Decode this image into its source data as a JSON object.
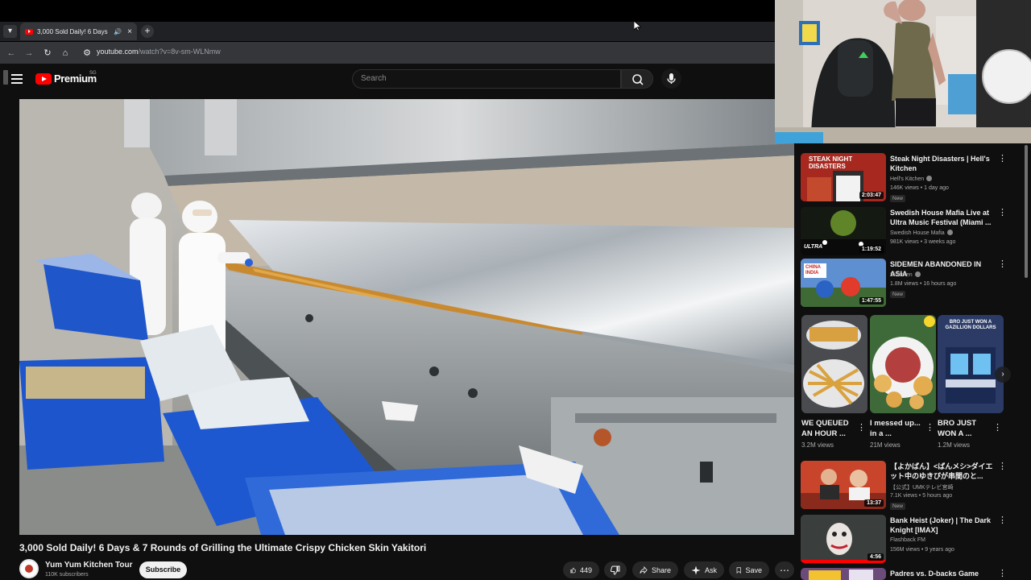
{
  "browser": {
    "tab_title": "3,000 Sold Daily! 6 Days &",
    "new_tab_label": "+",
    "url_host": "youtube.com",
    "url_path": "/watch?v=8v-sm-WLNmw"
  },
  "header": {
    "logo_text": "Premium",
    "country_code": "SG",
    "search_placeholder": "Search"
  },
  "video": {
    "title": "3,000 Sold Daily! 6 Days & 7 Rounds of Grilling the Ultimate Crispy Chicken Skin Yakitori",
    "channel": "Yum Yum Kitchen Tour",
    "subscribers": "110K subscribers",
    "subscribe_label": "Subscribe",
    "likes": "449",
    "share_label": "Share",
    "ask_label": "Ask",
    "save_label": "Save"
  },
  "sidebar": {
    "recommendations": [
      {
        "title": "Steak Night Disasters | Hell's Kitchen",
        "channel": "Hell's Kitchen",
        "meta": "146K views • 1 day ago",
        "badge": "New",
        "duration": "2:03:47",
        "thumb_text": "STEAK NIGHT DISASTERS",
        "thumb_color": "#b3261e"
      },
      {
        "title": "Swedish House Mafia Live at Ultra Music Festival (Miami ...",
        "channel": "Swedish House Mafia",
        "meta": "981K views • 3 weeks ago",
        "badge": "",
        "duration": "1:19:52",
        "thumb_text": "ULTRA",
        "thumb_color": "#1d2a1a"
      },
      {
        "title": "SIDEMEN ABANDONED IN ASIA",
        "channel": "Sidemen",
        "meta": "1.8M views • 16 hours ago",
        "badge": "New",
        "duration": "1:47:55",
        "thumb_text": "CHINA INDIA",
        "thumb_color": "#3d6fb6"
      },
      {
        "title": "【よかばん】<ばんメシ>ダイエット中のゆきぴが串間のと...",
        "channel": "【公式】UMKテレビ宮崎",
        "meta": "7.1K views • 5 hours ago",
        "badge": "New",
        "duration": "13:37",
        "thumb_text": "",
        "thumb_color": "#c97c2a"
      },
      {
        "title": "Bank Heist (Joker) | The Dark Knight [IMAX]",
        "channel": "Flashback FM",
        "meta": "156M views • 9 years ago",
        "badge": "",
        "duration": "4:56",
        "thumb_text": "",
        "thumb_color": "#2b2b2b"
      },
      {
        "title": "Padres vs. D-backs Game",
        "channel": "",
        "meta": "",
        "badge": "",
        "duration": "",
        "thumb_text": "",
        "thumb_color": "#6b4b7a"
      }
    ],
    "shorts": [
      {
        "title": "WE QUEUED AN HOUR ...",
        "views": "3.2M views",
        "thumb_color": "#c6a35a"
      },
      {
        "title": "I messed up... in a ...",
        "views": "21M views",
        "thumb_color": "#d9a055"
      },
      {
        "title": "BRO JUST WON A ...",
        "views": "1.2M views",
        "thumb_color": "#4a6fa5",
        "thumb_text": "BRO JUST WON A GAZILLION DOLLARS"
      }
    ]
  },
  "icons": {
    "tab_menu": "chevron-down-icon",
    "speaker": "speaker-icon",
    "close": "close-icon",
    "back": "back-arrow-icon",
    "forward": "forward-arrow-icon",
    "reload": "reload-icon",
    "home": "home-icon",
    "site_info": "site-info-icon",
    "search": "search-icon",
    "mic": "mic-icon",
    "like": "thumbs-up-icon",
    "dislike": "thumbs-down-icon",
    "more": "more-horizontal-icon"
  }
}
